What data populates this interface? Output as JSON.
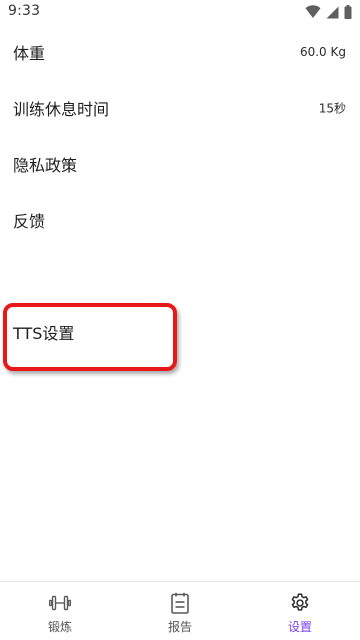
{
  "status_bar": {
    "time": "9:33"
  },
  "settings": {
    "items": [
      {
        "label": "体重",
        "value": "60.0 Kg"
      },
      {
        "label": "训练休息时间",
        "value": "15秒"
      },
      {
        "label": "隐私政策",
        "value": ""
      },
      {
        "label": "反馈",
        "value": ""
      },
      {
        "label": "TTS设置",
        "value": ""
      }
    ]
  },
  "bottom_nav": {
    "items": [
      {
        "label": "锻炼",
        "icon": "dumbbell-icon",
        "active": false
      },
      {
        "label": "报告",
        "icon": "clipboard-icon",
        "active": false
      },
      {
        "label": "设置",
        "icon": "gear-icon",
        "active": true
      }
    ]
  },
  "colors": {
    "accent": "#7b3ff2",
    "highlight": "#e81818",
    "text": "#1f1f1f"
  }
}
